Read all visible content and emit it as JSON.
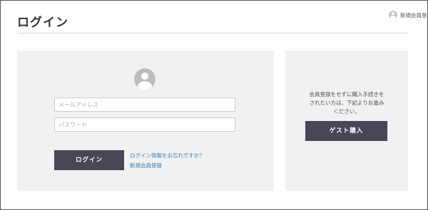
{
  "header": {
    "title": "ログイン",
    "register_link": "新規会員登録"
  },
  "login": {
    "email_placeholder": "メールアドレス",
    "password_placeholder": "パスワード",
    "login_button": "ログイン",
    "forgot_link": "ログイン情報をお忘れですか？",
    "register_link": "新規会員登録"
  },
  "guest": {
    "description_lines": [
      "会員登録をせずに購入手続きを",
      "されたい方は、下記よりお進み",
      "ください。"
    ],
    "guest_button": "ゲスト購入"
  },
  "icons": {
    "user_avatar": "user-avatar-icon",
    "header_user": "user-icon"
  },
  "colors": {
    "button_bg": "#4a4656",
    "panel_bg": "#f0f1f1",
    "link": "#3d7fb5"
  }
}
